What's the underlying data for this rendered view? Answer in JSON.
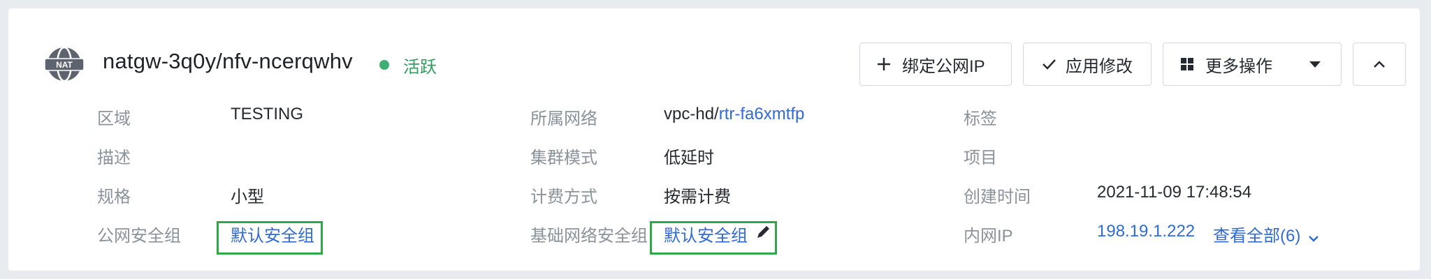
{
  "header": {
    "icon_text": "NAT",
    "title": "natgw-3q0y/nfv-ncerqwhv",
    "status": "活跃",
    "status_color": "#3fae74"
  },
  "toolbar": {
    "bind_ip_label": "绑定公网IP",
    "apply_label": "应用修改",
    "more_label": "更多操作",
    "collapse_icon": "chevron-up-icon"
  },
  "details": {
    "col1": {
      "region_label": "区域",
      "region_value": "TESTING",
      "desc_label": "描述",
      "desc_value": "",
      "spec_label": "规格",
      "spec_value": "小型",
      "public_sg_label": "公网安全组",
      "public_sg_value": "默认安全组"
    },
    "col2": {
      "network_label": "所属网络",
      "network_prefix": "vpc-hd/",
      "network_link": "rtr-fa6xmtfp",
      "cluster_label": "集群模式",
      "cluster_value": "低延时",
      "billing_label": "计费方式",
      "billing_value": "按需计费",
      "base_sg_label": "基础网络安全组",
      "base_sg_value": "默认安全组"
    },
    "col3": {
      "tag_label": "标签",
      "project_label": "项目",
      "created_label": "创建时间",
      "created_value": "2021-11-09 17:48:54",
      "private_ip_label": "内网IP",
      "private_ip_value": "198.19.1.222",
      "view_all_label": "查看全部(6)"
    }
  },
  "colors": {
    "link": "#2f6bd3",
    "highlight_border": "#2fa84a",
    "label": "#8a929c"
  }
}
